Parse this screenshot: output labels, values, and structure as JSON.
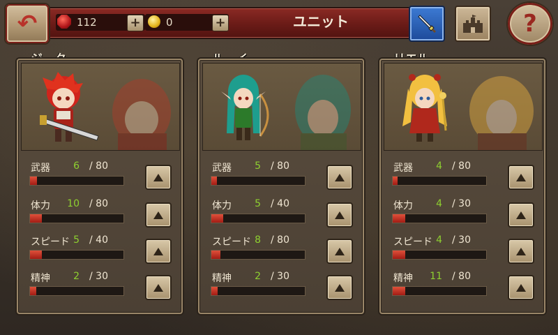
{
  "header": {
    "title": "ユニット",
    "gems": "112",
    "coins": "0",
    "back_icon": "back-arrow-icon",
    "help_label": "?"
  },
  "units": [
    {
      "name": "ジーク",
      "stats": [
        {
          "label": "武器",
          "value": "6",
          "max": "/ 80",
          "fill": 0.075
        },
        {
          "label": "体力",
          "value": "10",
          "max": "/ 80",
          "fill": 0.125
        },
        {
          "label": "スピード",
          "value": "5",
          "max": "/ 40",
          "fill": 0.125
        },
        {
          "label": "精神",
          "value": "2",
          "max": "/ 30",
          "fill": 0.067
        }
      ]
    },
    {
      "name": "ルーイ",
      "stats": [
        {
          "label": "武器",
          "value": "5",
          "max": "/ 80",
          "fill": 0.0625
        },
        {
          "label": "体力",
          "value": "5",
          "max": "/ 40",
          "fill": 0.125
        },
        {
          "label": "スピード",
          "value": "8",
          "max": "/ 80",
          "fill": 0.1
        },
        {
          "label": "精神",
          "value": "2",
          "max": "/ 30",
          "fill": 0.067
        }
      ]
    },
    {
      "name": "リエル",
      "stats": [
        {
          "label": "武器",
          "value": "4",
          "max": "/ 80",
          "fill": 0.05
        },
        {
          "label": "体力",
          "value": "4",
          "max": "/ 30",
          "fill": 0.133
        },
        {
          "label": "スピード",
          "value": "4",
          "max": "/ 30",
          "fill": 0.133
        },
        {
          "label": "精神",
          "value": "11",
          "max": "/ 80",
          "fill": 0.1375
        }
      ]
    }
  ],
  "colors": {
    "hair": [
      "#d0241c",
      "#1e9e8e",
      "#f2c040"
    ],
    "outfit": [
      "#a8221a",
      "#2c7a2a",
      "#b0281c"
    ],
    "bar_fill": "#c8301e",
    "stat_value": "#8ed030"
  }
}
